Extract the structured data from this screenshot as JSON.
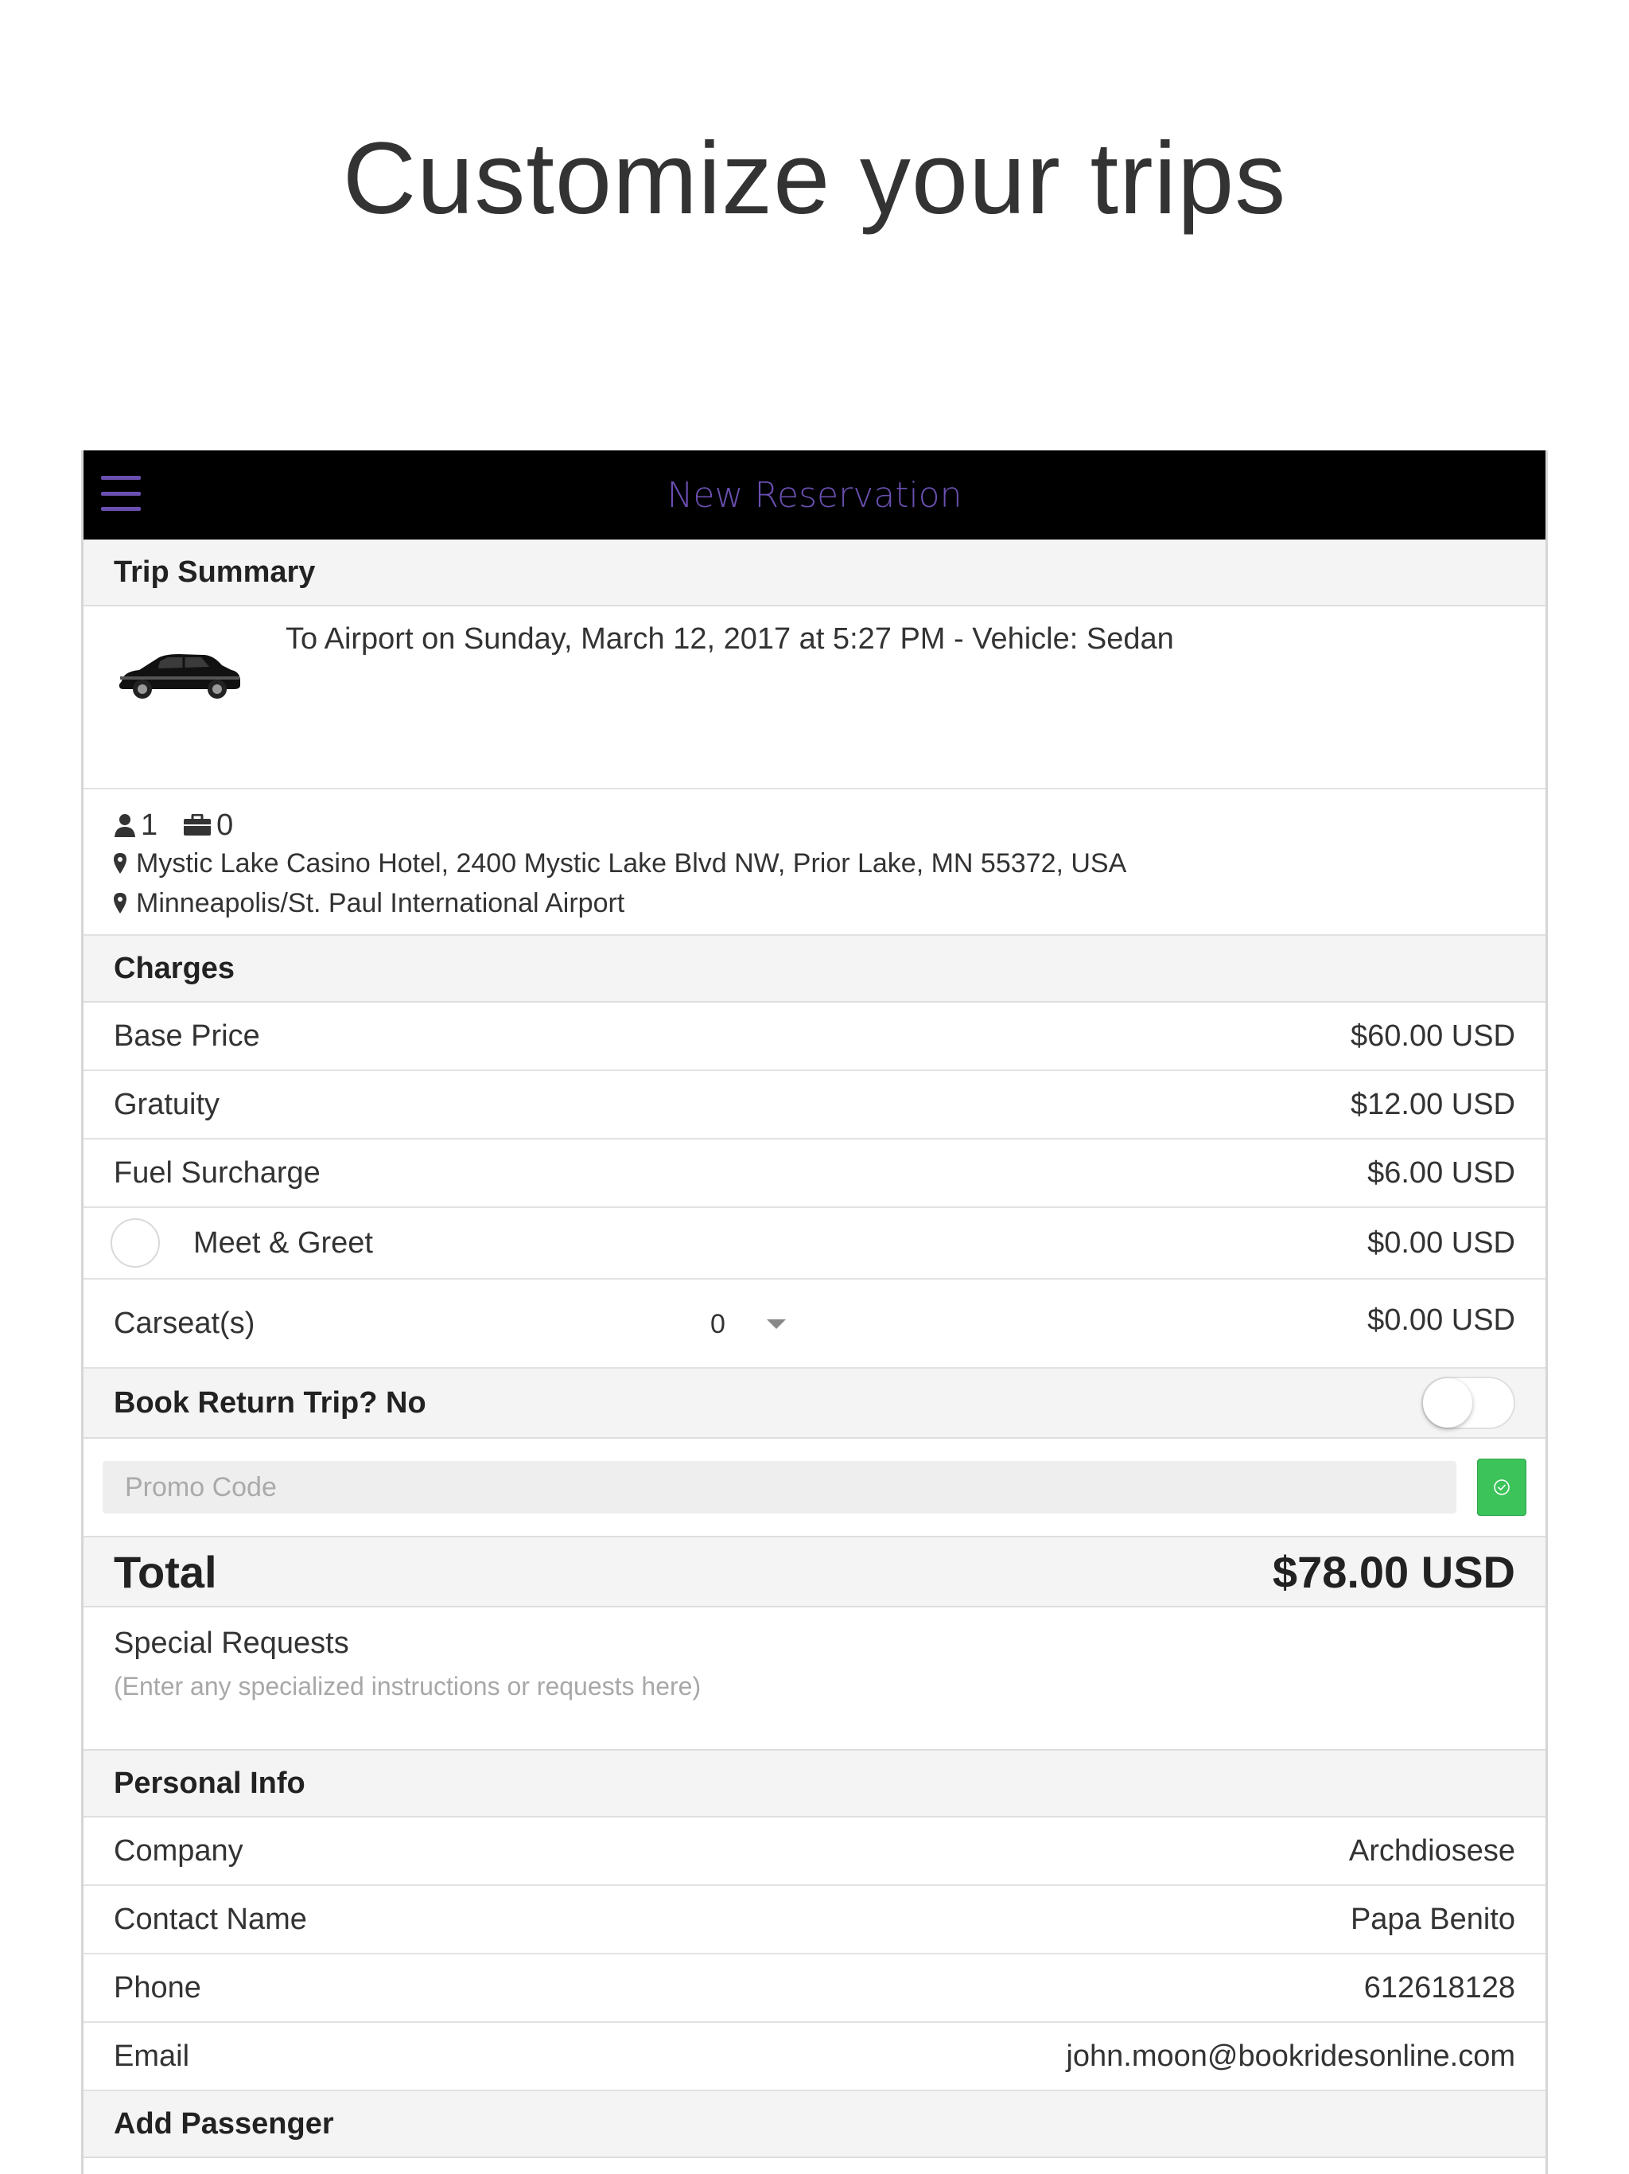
{
  "headline": "Customize your trips",
  "navbar": {
    "title": "New Reservation",
    "menu_icon": "hamburger-icon",
    "accent": "#6a4fb0"
  },
  "trip_summary": {
    "header": "Trip Summary",
    "description": "To Airport on Sunday, March 12, 2017 at 5:27 PM - Vehicle: Sedan",
    "passengers": "1",
    "luggage": "0",
    "pickup": "Mystic Lake Casino Hotel, 2400 Mystic Lake Blvd NW, Prior Lake, MN 55372, USA",
    "dropoff": "Minneapolis/St. Paul International Airport"
  },
  "charges": {
    "header": "Charges",
    "base_price": {
      "label": "Base Price",
      "value": "$60.00 USD"
    },
    "gratuity": {
      "label": "Gratuity",
      "value": "$12.00 USD"
    },
    "fuel": {
      "label": "Fuel Surcharge",
      "value": "$6.00 USD"
    },
    "meet_greet": {
      "label": "Meet & Greet",
      "value": "$0.00 USD"
    },
    "carseat": {
      "label": "Carseat(s)",
      "selected": "0",
      "value": "$0.00 USD"
    }
  },
  "return_trip": {
    "label": "Book Return Trip? No"
  },
  "promo": {
    "placeholder": "Promo Code",
    "button_color": "#3cc35a"
  },
  "total": {
    "label": "Total",
    "value": "$78.00 USD"
  },
  "special_requests": {
    "title": "Special Requests",
    "hint": "(Enter any specialized instructions or requests here)"
  },
  "personal_info": {
    "header": "Personal Info",
    "company": {
      "label": "Company",
      "value": "Archdiosese"
    },
    "contact": {
      "label": "Contact Name",
      "value": "Papa Benito"
    },
    "phone": {
      "label": "Phone",
      "value": "612618128"
    },
    "email": {
      "label": "Email",
      "value": "john.moon@bookridesonline.com"
    }
  },
  "add_passenger": {
    "header": "Add Passenger"
  }
}
